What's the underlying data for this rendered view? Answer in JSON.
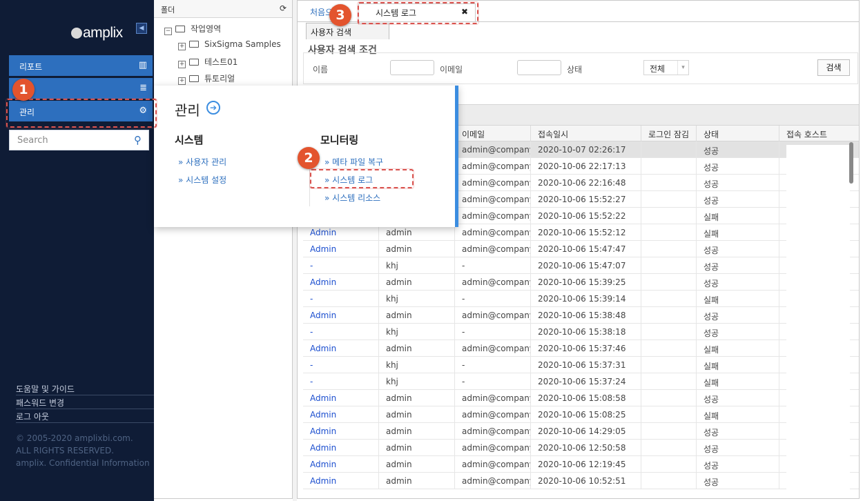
{
  "sidebar": {
    "logo": "amplix",
    "items": [
      {
        "label": "리포트",
        "icon": "bar-chart-icon",
        "glyph": "📊"
      },
      {
        "label": "",
        "icon": "database-icon",
        "glyph": "≣"
      },
      {
        "label": "관리",
        "icon": "gear-icon",
        "glyph": "⚙"
      }
    ],
    "search_placeholder": "Search",
    "footer_links": [
      "도움말 및 가이드",
      "패스워드 변경",
      "로그 아웃"
    ],
    "copyright": [
      "© 2005-2020 amplixbi.com.",
      "ALL RIGHTS RESERVED.",
      "amplix. Confidential Information"
    ]
  },
  "folder": {
    "title": "폴더",
    "tree": [
      {
        "label": "작업영역",
        "toggle": "−"
      },
      {
        "label": "SixSigma Samples",
        "toggle": "+"
      },
      {
        "label": "테스트01",
        "toggle": "+"
      },
      {
        "label": "튜토리얼",
        "toggle": "+"
      }
    ]
  },
  "tabs": {
    "first": "처음으",
    "active": "시스템 로그",
    "close": "✖",
    "subtab": "사용자 검색"
  },
  "search": {
    "section_title": "사용자 검색 조건",
    "name_label": "이름",
    "email_label": "이메일",
    "status_label": "상태",
    "status_value": "전체",
    "search_button": "검색"
  },
  "grid": {
    "headers": [
      "",
      "",
      "이메일",
      "접속일시",
      "로그인 잠김",
      "상태",
      "접속 호스트"
    ],
    "rows": [
      [
        "",
        "",
        "admin@company.",
        "2020-10-07 02:26:17",
        "",
        "성공"
      ],
      [
        "",
        "",
        "admin@company.",
        "2020-10-06 22:17:13",
        "",
        "성공"
      ],
      [
        "",
        "",
        "admin@company.",
        "2020-10-06 22:16:48",
        "",
        "성공"
      ],
      [
        "",
        "",
        "admin@company.",
        "2020-10-06 15:52:27",
        "",
        "성공"
      ],
      [
        "",
        "",
        "admin@company.",
        "2020-10-06 15:52:22",
        "",
        "실패"
      ],
      [
        "Admin",
        "admin",
        "admin@company.",
        "2020-10-06 15:52:12",
        "",
        "실패"
      ],
      [
        "Admin",
        "admin",
        "admin@company.",
        "2020-10-06 15:47:47",
        "",
        "성공"
      ],
      [
        "-",
        "khj",
        "-",
        "2020-10-06 15:47:07",
        "",
        "성공"
      ],
      [
        "Admin",
        "admin",
        "admin@company.",
        "2020-10-06 15:39:25",
        "",
        "성공"
      ],
      [
        "-",
        "khj",
        "-",
        "2020-10-06 15:39:14",
        "",
        "실패"
      ],
      [
        "Admin",
        "admin",
        "admin@company.",
        "2020-10-06 15:38:48",
        "",
        "성공"
      ],
      [
        "-",
        "khj",
        "-",
        "2020-10-06 15:38:18",
        "",
        "성공"
      ],
      [
        "Admin",
        "admin",
        "admin@company.",
        "2020-10-06 15:37:46",
        "",
        "실패"
      ],
      [
        "-",
        "khj",
        "-",
        "2020-10-06 15:37:31",
        "",
        "실패"
      ],
      [
        "-",
        "khj",
        "-",
        "2020-10-06 15:37:24",
        "",
        "실패"
      ],
      [
        "Admin",
        "admin",
        "admin@company.",
        "2020-10-06 15:08:58",
        "",
        "성공"
      ],
      [
        "Admin",
        "admin",
        "admin@company.",
        "2020-10-06 15:08:25",
        "",
        "실패"
      ],
      [
        "Admin",
        "admin",
        "admin@company.",
        "2020-10-06 14:29:05",
        "",
        "성공"
      ],
      [
        "Admin",
        "admin",
        "admin@company.",
        "2020-10-06 12:50:58",
        "",
        "성공"
      ],
      [
        "Admin",
        "admin",
        "admin@company.",
        "2020-10-06 12:19:45",
        "",
        "성공"
      ],
      [
        "Admin",
        "admin",
        "admin@company.",
        "2020-10-06 10:52:51",
        "",
        "성공"
      ]
    ]
  },
  "mega_menu": {
    "title": "관리",
    "system": {
      "heading": "시스템",
      "links": [
        "» 사용자 관리",
        "» 시스템 설정"
      ]
    },
    "monitoring": {
      "heading": "모니터링",
      "links": [
        "» 메타 파일 복구",
        "» 시스템 로그",
        "» 시스템 리소스"
      ]
    }
  },
  "annotations": {
    "badges": [
      "1",
      "2",
      "3"
    ],
    "color": "#e3542e"
  }
}
